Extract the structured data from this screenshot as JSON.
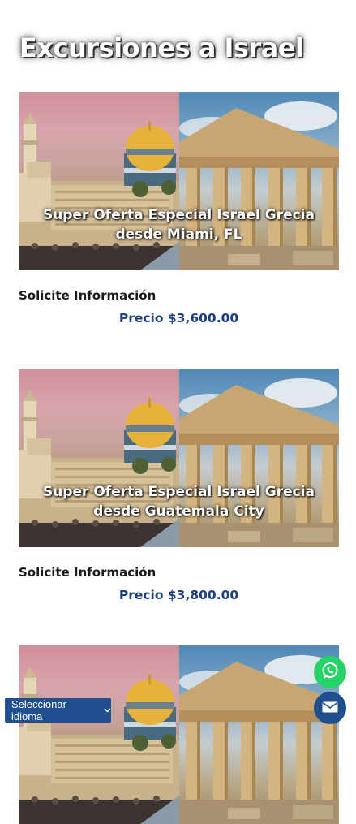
{
  "page": {
    "title": "Excursiones a Israel"
  },
  "tours": [
    {
      "caption": "Super Oferta Especial Israel Grecia desde Miami, FL",
      "info_link": "Solicite Información",
      "price": "Precio $3,600.00"
    },
    {
      "caption": "Super Oferta Especial Israel Grecia desde Guatemala City",
      "info_link": "Solicite Información",
      "price": "Precio $3,800.00"
    },
    {
      "caption": "",
      "info_link": "",
      "price": ""
    }
  ],
  "footer": {
    "language_select": "Seleccionar idioma"
  },
  "icons": {
    "whatsapp": "whatsapp-icon",
    "email": "envelope-icon",
    "chevron": "chevron-down-icon"
  },
  "colors": {
    "price": "#1e3f7e",
    "language_bar": "#1f4f8e",
    "whatsapp": "#25d366",
    "email_button": "#1f4f8e"
  }
}
